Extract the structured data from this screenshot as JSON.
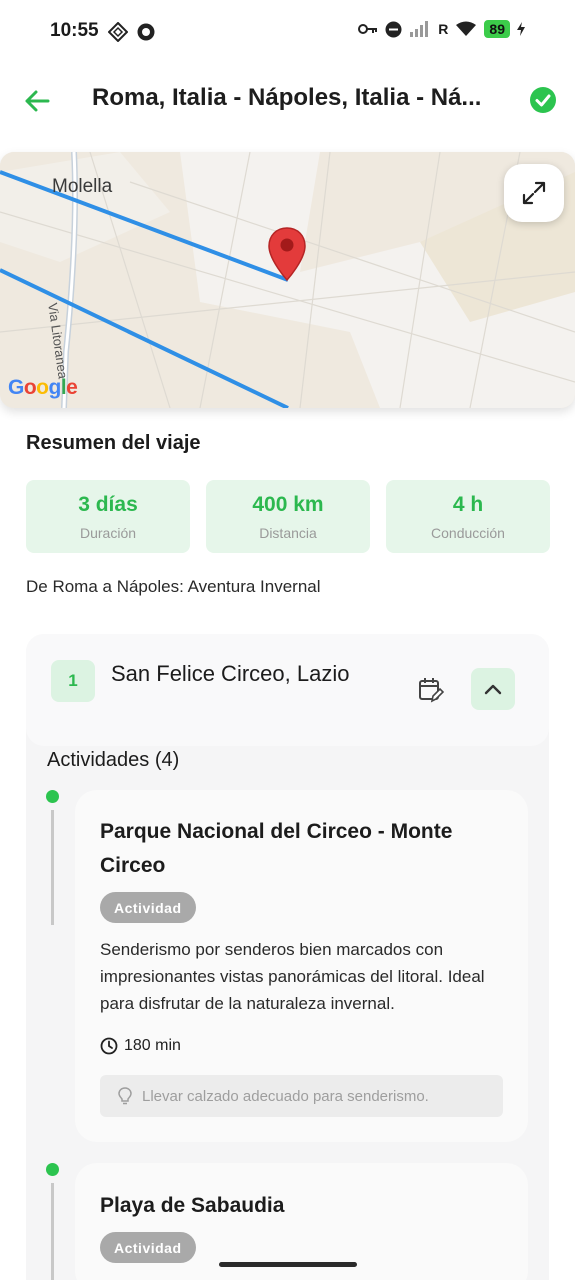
{
  "status_bar": {
    "time": "10:55",
    "battery": "89"
  },
  "app_bar": {
    "title": "Roma, Italia - Nápoles, Italia - Ná..."
  },
  "map": {
    "place_label": "Molella",
    "road_label": "Via Litoranea",
    "google_logo": "Google"
  },
  "summary": {
    "title": "Resumen del viaje",
    "stats": [
      {
        "value": "3 días",
        "label": "Duración"
      },
      {
        "value": "400 km",
        "label": "Distancia"
      },
      {
        "value": "4 h",
        "label": "Conducción"
      }
    ],
    "description": "De Roma a Nápoles: Aventura Invernal"
  },
  "day": {
    "number": "1",
    "name": "San Felice Circeo, Lazio",
    "activities_title": "Actividades (4)",
    "activities": [
      {
        "title": "Parque Nacional del Circeo - Monte Circeo",
        "chip": "Actividad",
        "description": "Senderismo por senderos bien marcados con impresionantes vistas panorámicas del litoral. Ideal para disfrutar de la naturaleza invernal.",
        "duration": "180 min",
        "tip": "Llevar calzado adecuado para senderismo."
      },
      {
        "title": "Playa de Sabaudia",
        "chip": "Actividad"
      }
    ]
  },
  "colors": {
    "accent": "#2cb84f",
    "route": "#2f8fe6",
    "pin": "#e33b3b"
  }
}
